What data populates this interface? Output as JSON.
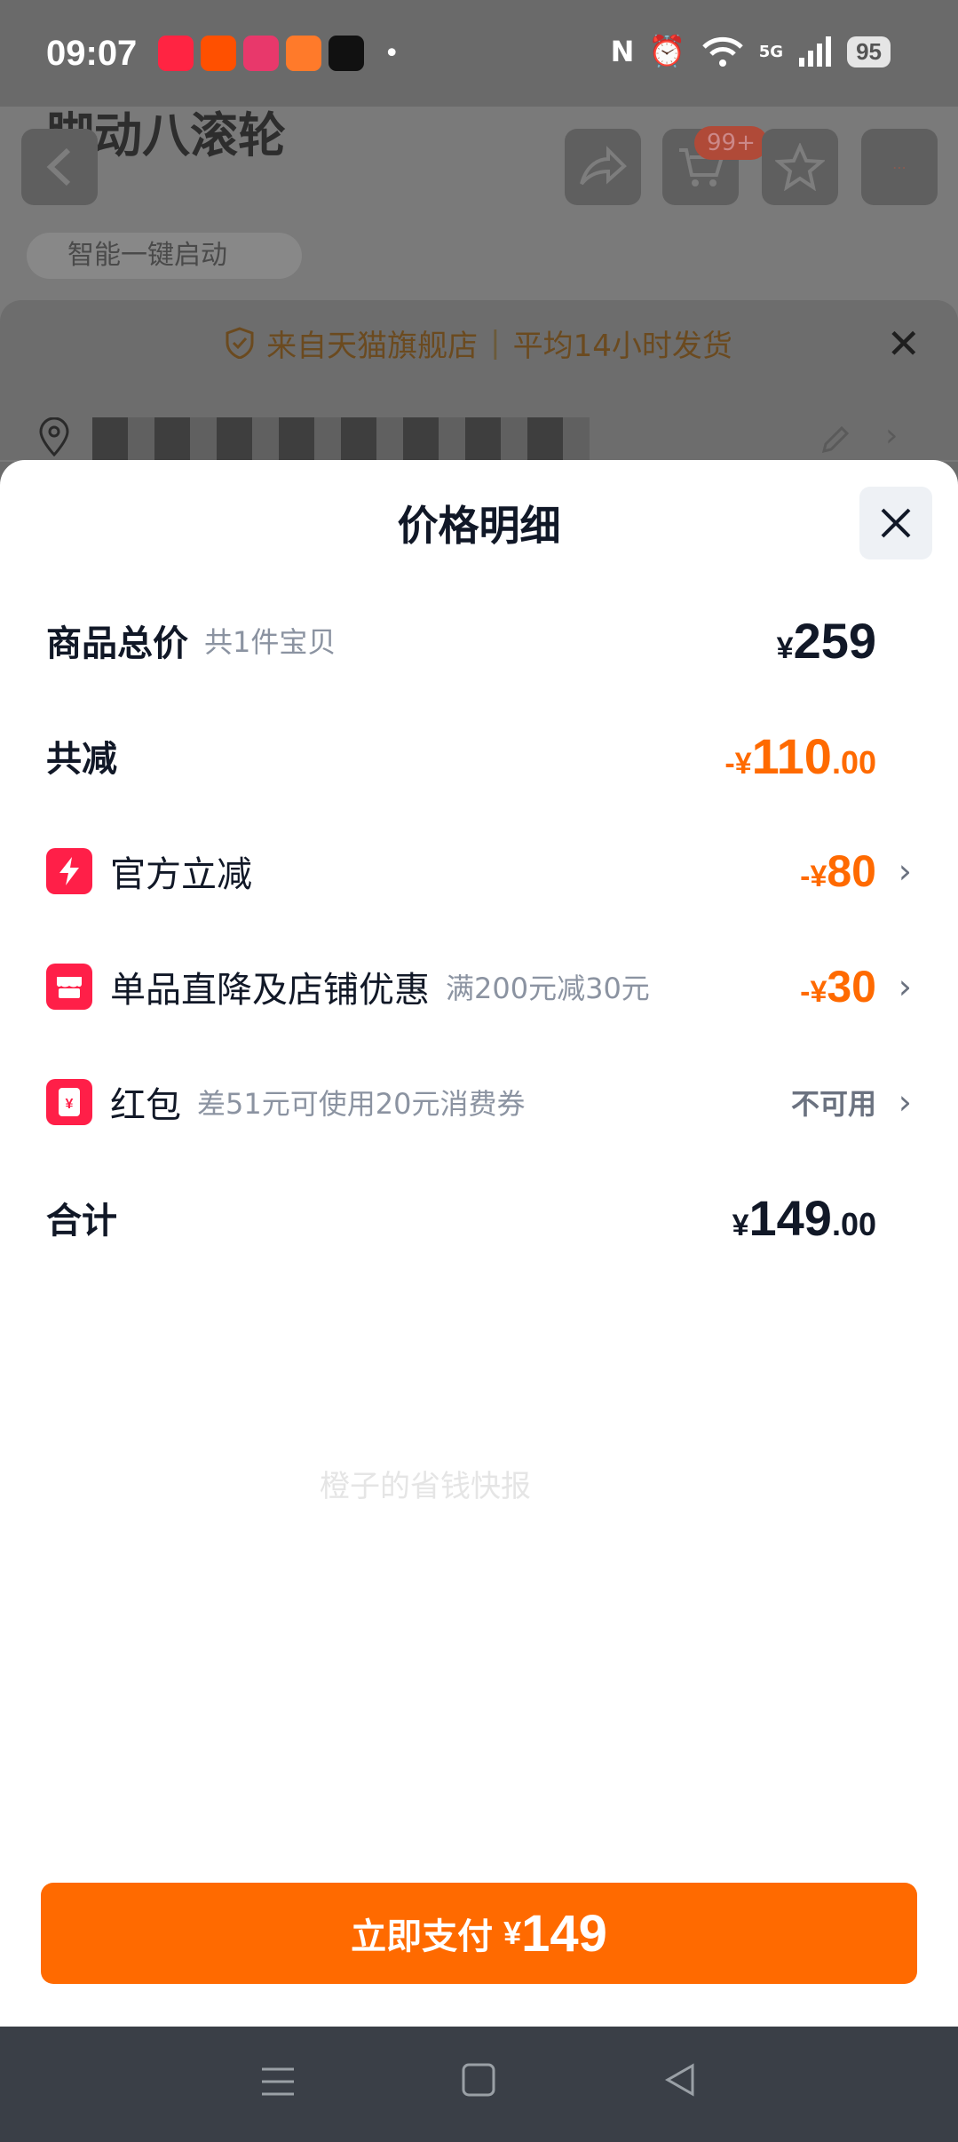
{
  "status_bar": {
    "time": "09:07",
    "apps": [
      "xiaohongshu",
      "taobao",
      "taobao-games",
      "taobao-mall",
      "tiktok"
    ],
    "battery": "95",
    "network": "5G"
  },
  "background": {
    "product_title": "脚动八滚轮",
    "cart_badge": "99+",
    "feature_chip": "智能一键启动",
    "shop_info": {
      "source": "来自天猫旗舰店",
      "shipping": "平均14小时发货"
    }
  },
  "sheet": {
    "title": "价格明细",
    "rows": {
      "total": {
        "label": "商品总价",
        "sub": "共1件宝贝",
        "yen": "¥",
        "amount": "259"
      },
      "discount": {
        "label": "共减",
        "prefix": "-¥",
        "amount": "110",
        "decimal": ".00"
      },
      "official": {
        "label": "官方立减",
        "prefix": "-¥",
        "amount": "80"
      },
      "shop": {
        "label": "单品直降及店铺优惠",
        "sub": "满200元减30元",
        "prefix": "-¥",
        "amount": "30"
      },
      "redpacket": {
        "label": "红包",
        "sub": "差51元可使用20元消费券",
        "status": "不可用"
      },
      "sum": {
        "label": "合计",
        "yen": "¥",
        "amount": "149",
        "decimal": ".00"
      }
    },
    "watermark": "橙子的省钱快报",
    "pay_button": {
      "label": "立即支付",
      "yen": "¥",
      "amount": "149"
    }
  },
  "colors": {
    "accent": "#ff6a00",
    "icon_red": "#ff1f48",
    "text_dark": "#111827",
    "text_gray": "#8b93a1"
  }
}
